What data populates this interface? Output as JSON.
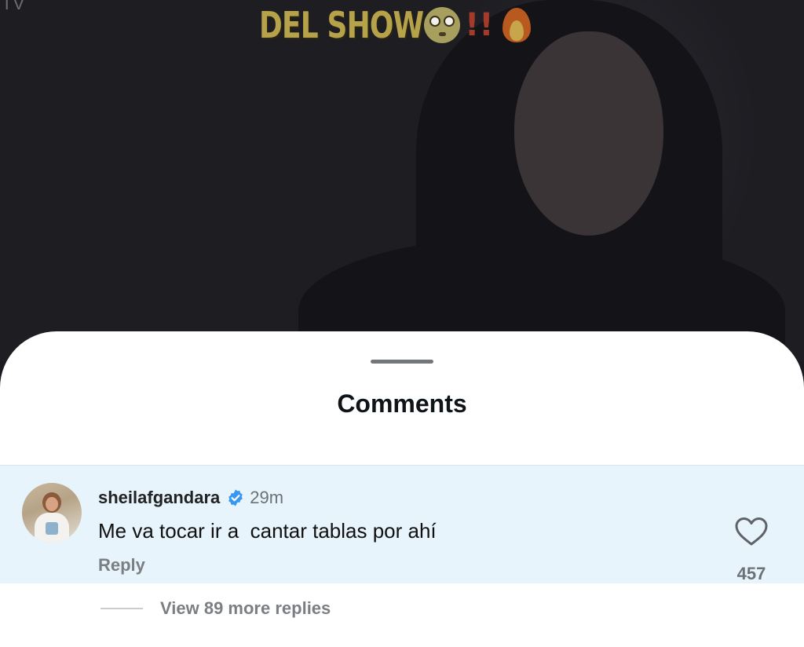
{
  "video": {
    "watermark": "TV",
    "caption": "DEL SHOW",
    "caption_emojis": [
      "flushed-face",
      "double-exclamation",
      "fire"
    ],
    "exclamation": "!!"
  },
  "sheet": {
    "title": "Comments"
  },
  "comment": {
    "username": "sheilafgandara",
    "verified": true,
    "timestamp": "29m",
    "text": "Me va tocar ir a  cantar tablas por ahí",
    "reply_label": "Reply",
    "like_count": "457",
    "view_replies_label": "View 89 more replies"
  },
  "colors": {
    "highlight_bg": "#e8f4fc",
    "verified_blue": "#3897f0",
    "muted_text": "#7b7f84"
  }
}
